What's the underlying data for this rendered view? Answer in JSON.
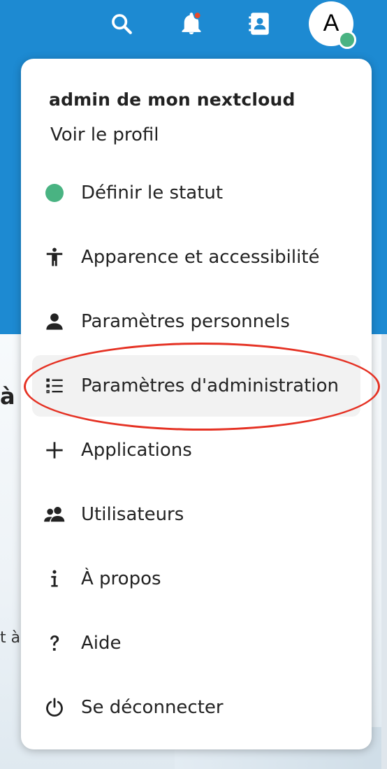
{
  "header": {
    "icons": [
      "search-icon",
      "notifications-icon",
      "contacts-icon"
    ],
    "avatar_letter": "A",
    "status_color": "#49b382",
    "notification_color": "#e64a2a"
  },
  "background": {
    "partial_text_1": "à",
    "partial_text_2": "t à"
  },
  "menu": {
    "title": "admin de mon nextcloud",
    "subtitle": "Voir le profil",
    "items": [
      {
        "label": "Définir le statut",
        "icon": "status-dot"
      },
      {
        "label": "Apparence et accessibilité",
        "icon": "accessibility-icon"
      },
      {
        "label": "Paramètres personnels",
        "icon": "user-icon"
      },
      {
        "label": "Paramètres d'administration",
        "icon": "admin-list-icon"
      },
      {
        "label": "Applications",
        "icon": "plus-icon"
      },
      {
        "label": "Utilisateurs",
        "icon": "users-icon"
      },
      {
        "label": "À propos",
        "icon": "info-icon"
      },
      {
        "label": "Aide",
        "icon": "help-icon"
      },
      {
        "label": "Se déconnecter",
        "icon": "power-icon"
      }
    ]
  },
  "annotation": {
    "color": "#e53224"
  }
}
